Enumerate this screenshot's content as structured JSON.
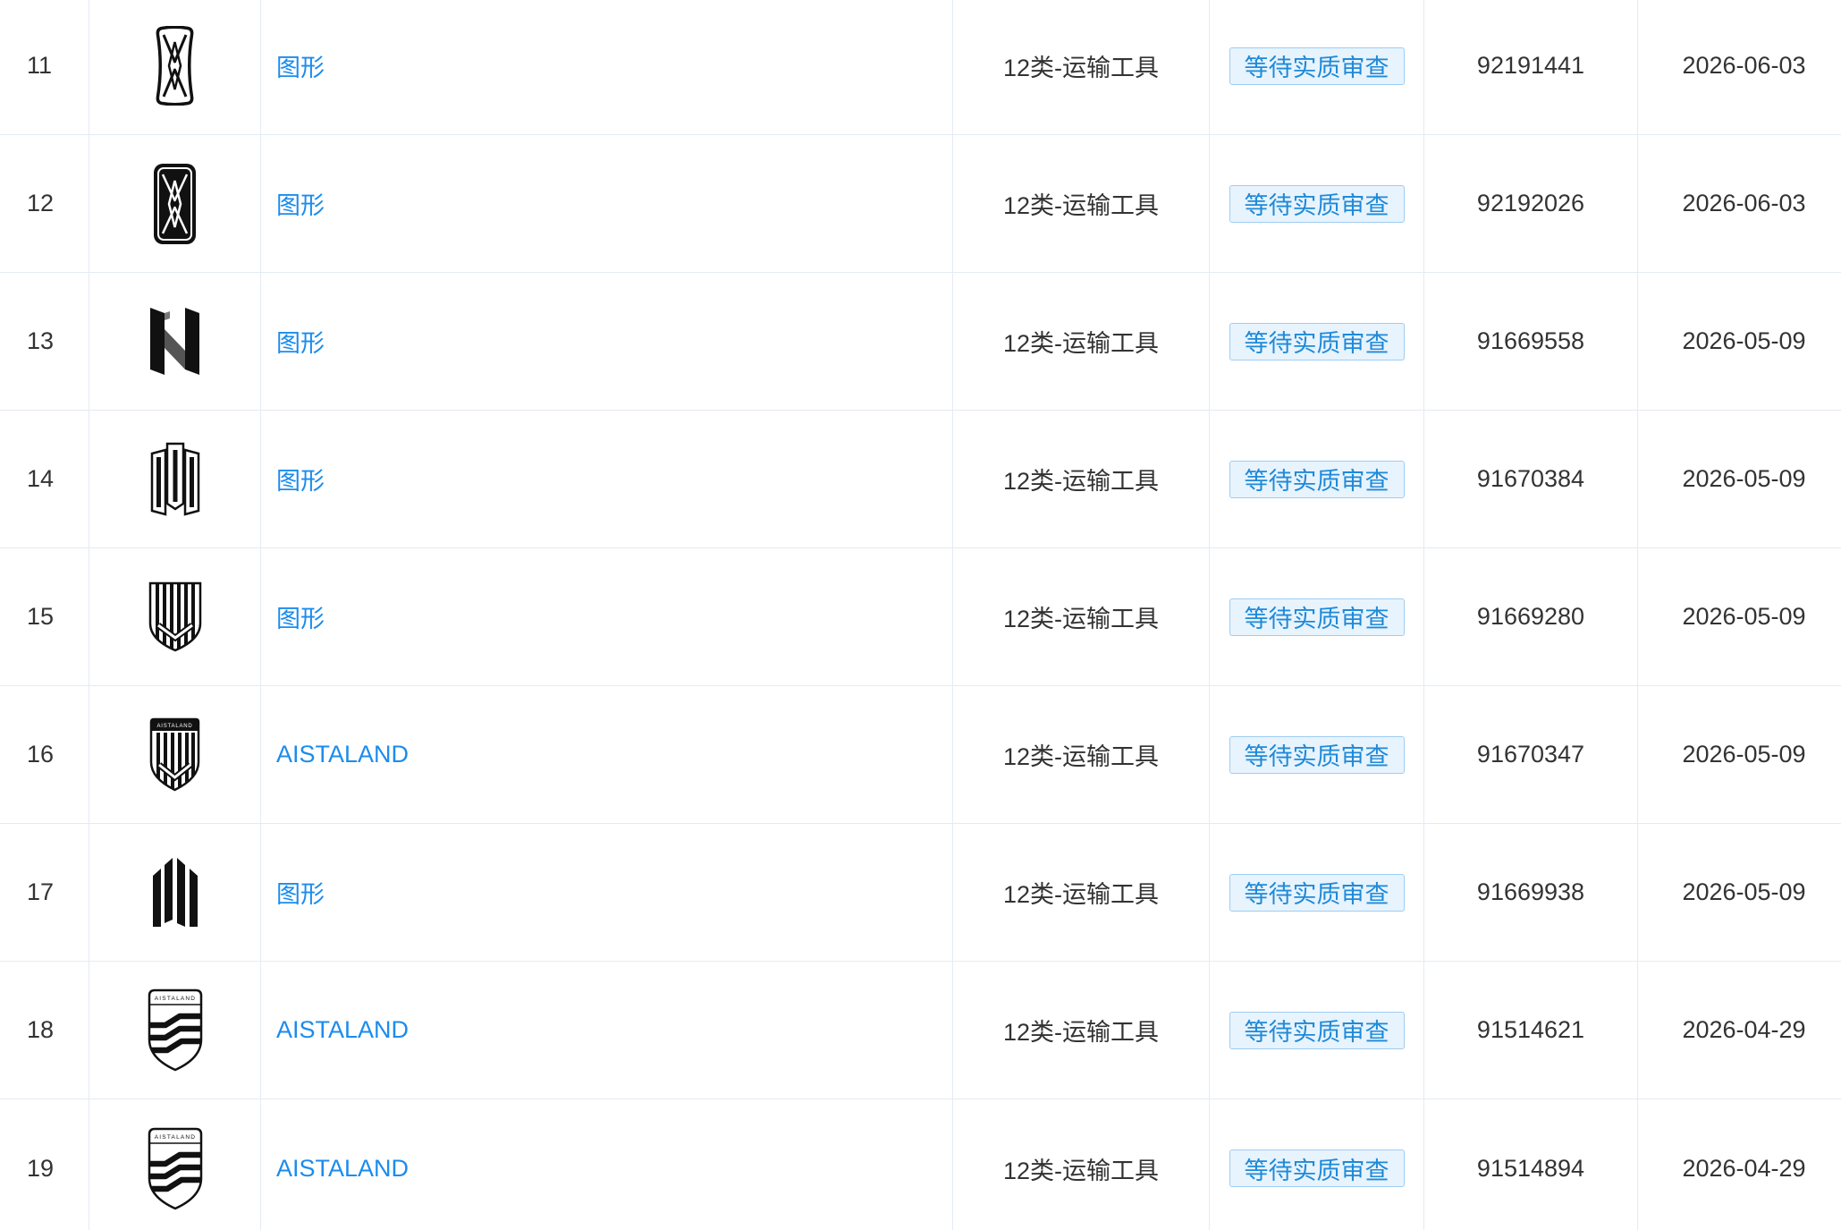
{
  "table": {
    "rows": [
      {
        "index": "11",
        "logo": "hourglass-frame-outline-icon",
        "name": "图形",
        "category": "12类-运输工具",
        "status": "等待实质审查",
        "reg_no": "92191441",
        "date": "2026-06-03"
      },
      {
        "index": "12",
        "logo": "hourglass-frame-filled-icon",
        "name": "图形",
        "category": "12类-运输工具",
        "status": "等待实质审查",
        "reg_no": "92192026",
        "date": "2026-06-03"
      },
      {
        "index": "13",
        "logo": "n-block-3d-icon",
        "name": "图形",
        "category": "12类-运输工具",
        "status": "等待实质审查",
        "reg_no": "91669558",
        "date": "2026-05-09"
      },
      {
        "index": "14",
        "logo": "pillars-outline-icon",
        "name": "图形",
        "category": "12类-运输工具",
        "status": "等待实质审查",
        "reg_no": "91670384",
        "date": "2026-05-09"
      },
      {
        "index": "15",
        "logo": "striped-shield-icon",
        "name": "图形",
        "category": "12类-运输工具",
        "status": "等待实质审查",
        "reg_no": "91669280",
        "date": "2026-05-09"
      },
      {
        "index": "16",
        "logo": "striped-shield-banner-icon",
        "logo_text": "AISTALAND",
        "name": "AISTALAND",
        "category": "12类-运输工具",
        "status": "等待实质审查",
        "reg_no": "91670347",
        "date": "2026-05-09"
      },
      {
        "index": "17",
        "logo": "staggered-bars-icon",
        "name": "图形",
        "category": "12类-运输工具",
        "status": "等待实质审查",
        "reg_no": "91669938",
        "date": "2026-05-09"
      },
      {
        "index": "18",
        "logo": "wave-shield-icon",
        "logo_text": "AISTALAND",
        "name": "AISTALAND",
        "category": "12类-运输工具",
        "status": "等待实质审查",
        "reg_no": "91514621",
        "date": "2026-04-29"
      },
      {
        "index": "19",
        "logo": "wave-shield-icon",
        "logo_text": "AISTALAND",
        "name": "AISTALAND",
        "category": "12类-运输工具",
        "status": "等待实质审查",
        "reg_no": "91514894",
        "date": "2026-04-29"
      }
    ]
  },
  "colors": {
    "link": "#1b8ced",
    "badge_bg": "#e7f3fd",
    "badge_border": "#9fcdf2",
    "badge_text": "#1f8ad8",
    "grid": "#e4ebf3",
    "text": "#333333"
  }
}
